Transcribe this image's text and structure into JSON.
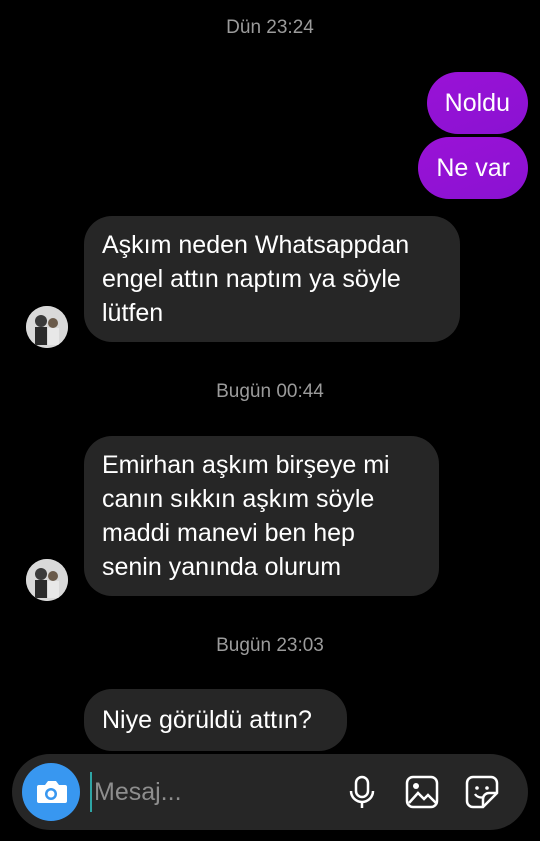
{
  "timestamps": [
    "Dün 23:24",
    "Bugün 00:44",
    "Bugün 23:03"
  ],
  "outgoing": [
    "Noldu",
    "Ne var"
  ],
  "incoming": [
    "Aşkım neden Whatsappdan\nengel attın naptım ya söyle\nlütfen",
    "Emirhan aşkım birşeye mi\ncanın sıkkın aşkım söyle\nmaddi manevi ben hep\nsenin yanında olurum",
    "Niye görüldü attın?"
  ],
  "composer": {
    "placeholder": "Mesaj..."
  },
  "colors": {
    "outgoing_bubble": "#8f12d4",
    "incoming_bubble": "#262626",
    "camera_button": "#3897f0"
  },
  "icons": [
    "camera-icon",
    "microphone-icon",
    "gallery-icon",
    "sticker-icon"
  ]
}
